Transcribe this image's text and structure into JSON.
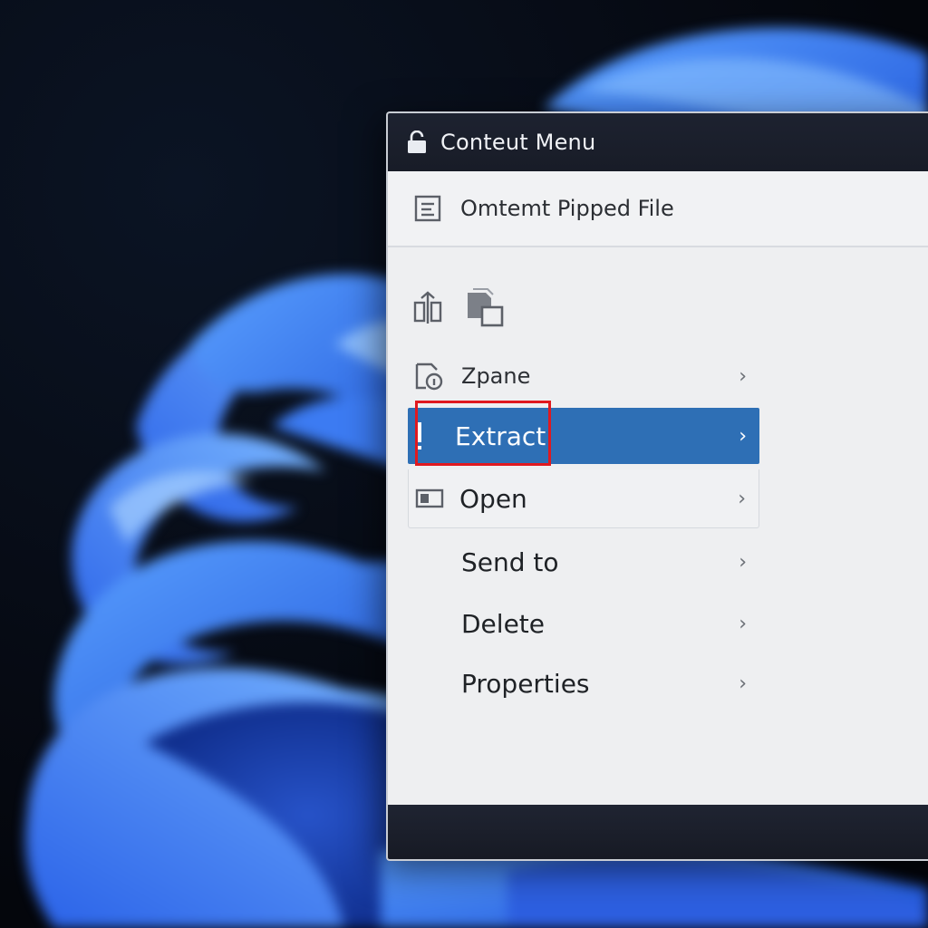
{
  "window": {
    "title": "Conteut Menu",
    "title_icon": "lock-icon"
  },
  "file_row": {
    "label": "Omtemt Pipped File",
    "icon": "document-icon"
  },
  "quick_actions": [
    {
      "icon": "compress-icon"
    },
    {
      "icon": "copy-icon"
    }
  ],
  "menu": {
    "items": [
      {
        "label": "Zpane",
        "icon": "zip-info-icon",
        "has_submenu": true
      },
      {
        "label": "Extract",
        "icon": "extract-icon",
        "has_submenu": true,
        "highlighted": true,
        "annotated": true
      },
      {
        "label": "Open",
        "icon": "window-icon",
        "has_submenu": true
      },
      {
        "label": "Send to",
        "has_submenu": true
      },
      {
        "label": "Delete",
        "has_submenu": true
      },
      {
        "label": "Properties",
        "has_submenu": true
      }
    ],
    "chevron": "›"
  },
  "colors": {
    "highlight": "#2e6fb5",
    "annotation": "#e0191f",
    "titlebar": "#1d2230",
    "menu_bg": "#eeeff1"
  }
}
